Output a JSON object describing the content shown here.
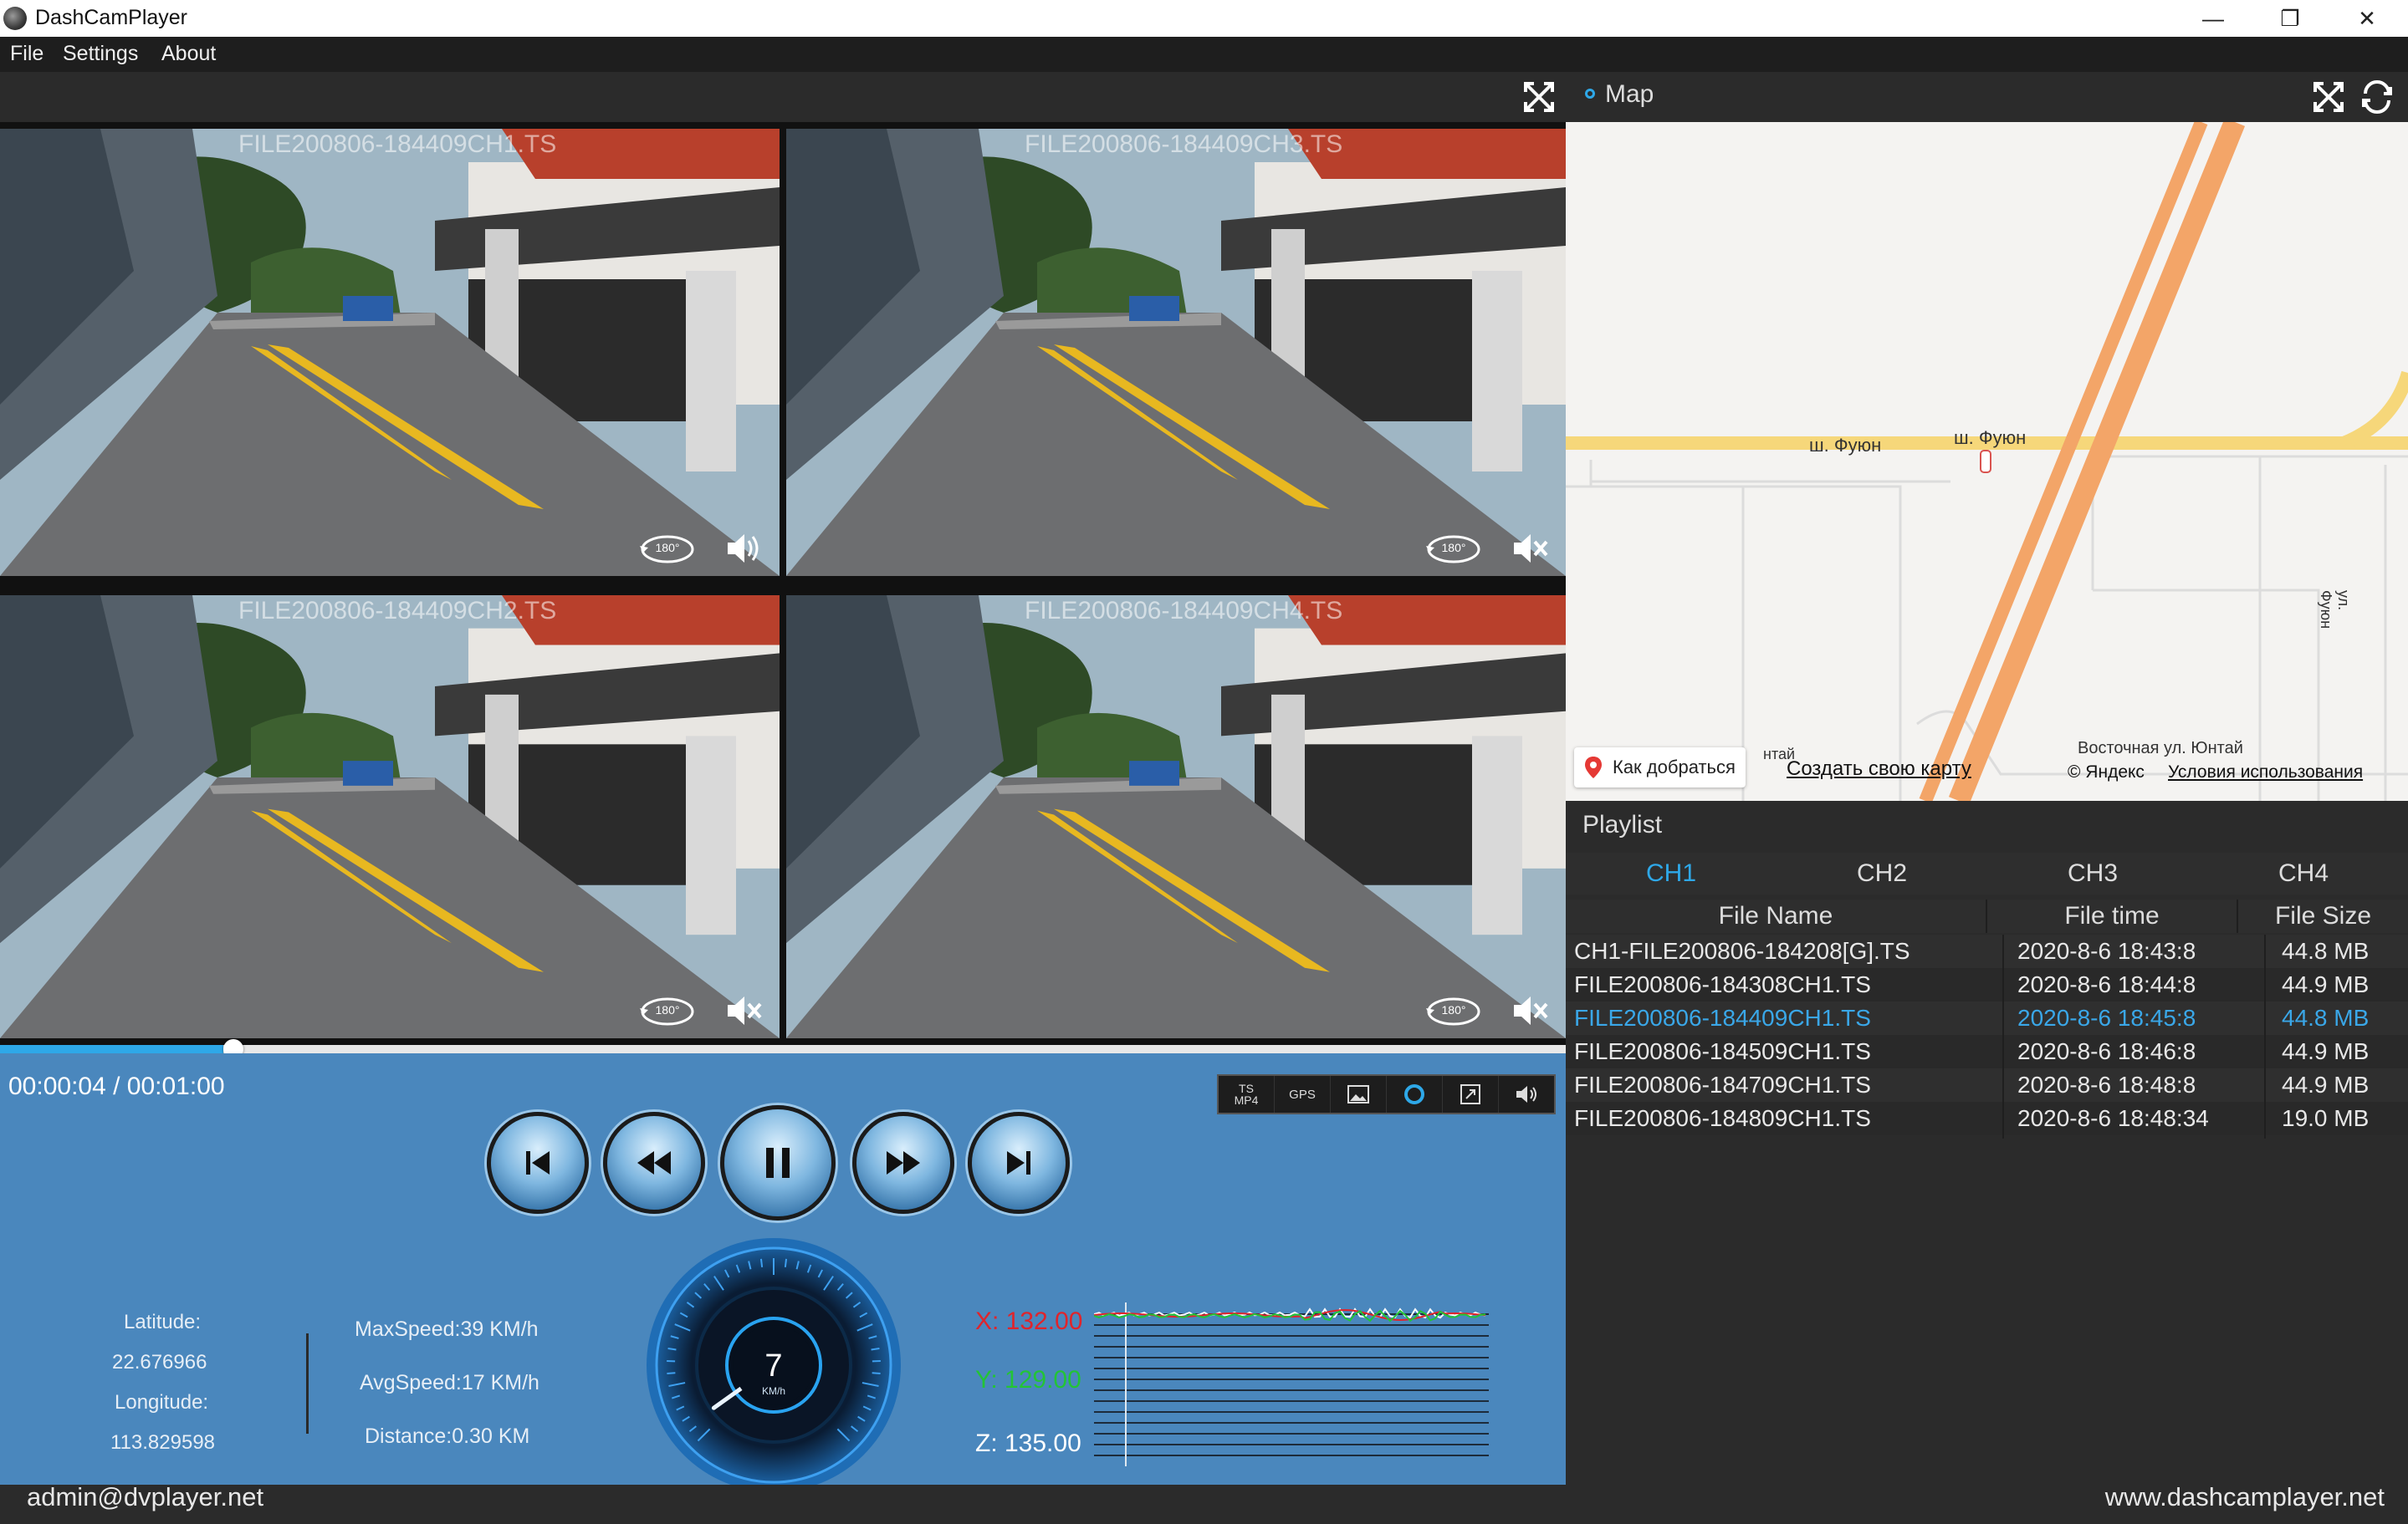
{
  "window": {
    "title": "DashCamPlayer",
    "minimize": "—",
    "maximize": "❐",
    "close": "✕"
  },
  "menu": [
    "File",
    "Settings",
    "About"
  ],
  "videos": [
    {
      "label": "FILE200806-184409CH1.TS",
      "sound": "on"
    },
    {
      "label": "FILE200806-184409CH3.TS",
      "sound": "muted"
    },
    {
      "label": "FILE200806-184409CH2.TS",
      "sound": "muted"
    },
    {
      "label": "FILE200806-184409CH4.TS",
      "sound": "muted"
    }
  ],
  "rotate_label": "180°",
  "playback": {
    "time": "00:00:04 / 00:01:00",
    "progress_fraction": 0.0667
  },
  "toolstrip": {
    "ts_mp4": "TS MP4",
    "gps": "GPS"
  },
  "gps": {
    "lat_label": "Latitude:",
    "lat": "22.676966",
    "lon_label": "Longitude:",
    "lon": "113.829598"
  },
  "stats": {
    "max_speed": "MaxSpeed:39 KM/h",
    "avg_speed": "AvgSpeed:17 KM/h",
    "distance": "Distance:0.30 KM"
  },
  "speedometer": {
    "value": "7",
    "unit": "KM/h",
    "max": 200
  },
  "gsensor": {
    "x": "X: 132.00",
    "y": "Y: 129.00",
    "z": "Z: 135.00",
    "colors": {
      "x": "#e0242b",
      "y": "#23c436",
      "z": "#ffffff"
    }
  },
  "map": {
    "title": "Map",
    "street1": "ш. Фуюн",
    "street2": "ш. Фуюн",
    "street3": "ул. Фуюн",
    "street4": "Восточная ул. Юнтай",
    "street5": "нтай",
    "directions": "Как добраться",
    "create_map": "Создать свою карту",
    "copyright": "© Яндекс",
    "terms": "Условия использования"
  },
  "playlist": {
    "title": "Playlist",
    "tabs": [
      "CH1",
      "CH2",
      "CH3",
      "CH4"
    ],
    "active_tab": 0,
    "columns": [
      "File Name",
      "File time",
      "File Size"
    ],
    "rows": [
      {
        "name": "CH1-FILE200806-184208[G].TS",
        "time": "2020-8-6 18:43:8",
        "size": "44.8 MB"
      },
      {
        "name": "FILE200806-184308CH1.TS",
        "time": "2020-8-6 18:44:8",
        "size": "44.9 MB"
      },
      {
        "name": "FILE200806-184409CH1.TS",
        "time": "2020-8-6 18:45:8",
        "size": "44.8 MB",
        "selected": true
      },
      {
        "name": "FILE200806-184509CH1.TS",
        "time": "2020-8-6 18:46:8",
        "size": "44.9 MB"
      },
      {
        "name": "FILE200806-184709CH1.TS",
        "time": "2020-8-6 18:48:8",
        "size": "44.9 MB"
      },
      {
        "name": "FILE200806-184809CH1.TS",
        "time": "2020-8-6 18:48:34",
        "size": "19.0 MB"
      }
    ]
  },
  "footer": {
    "left": "admin@dvplayer.net",
    "right": "www.dashcamplayer.net"
  },
  "colors": {
    "accent": "#2ea8e8",
    "panel": "#4a87bd",
    "dark": "#2b2b2b"
  }
}
